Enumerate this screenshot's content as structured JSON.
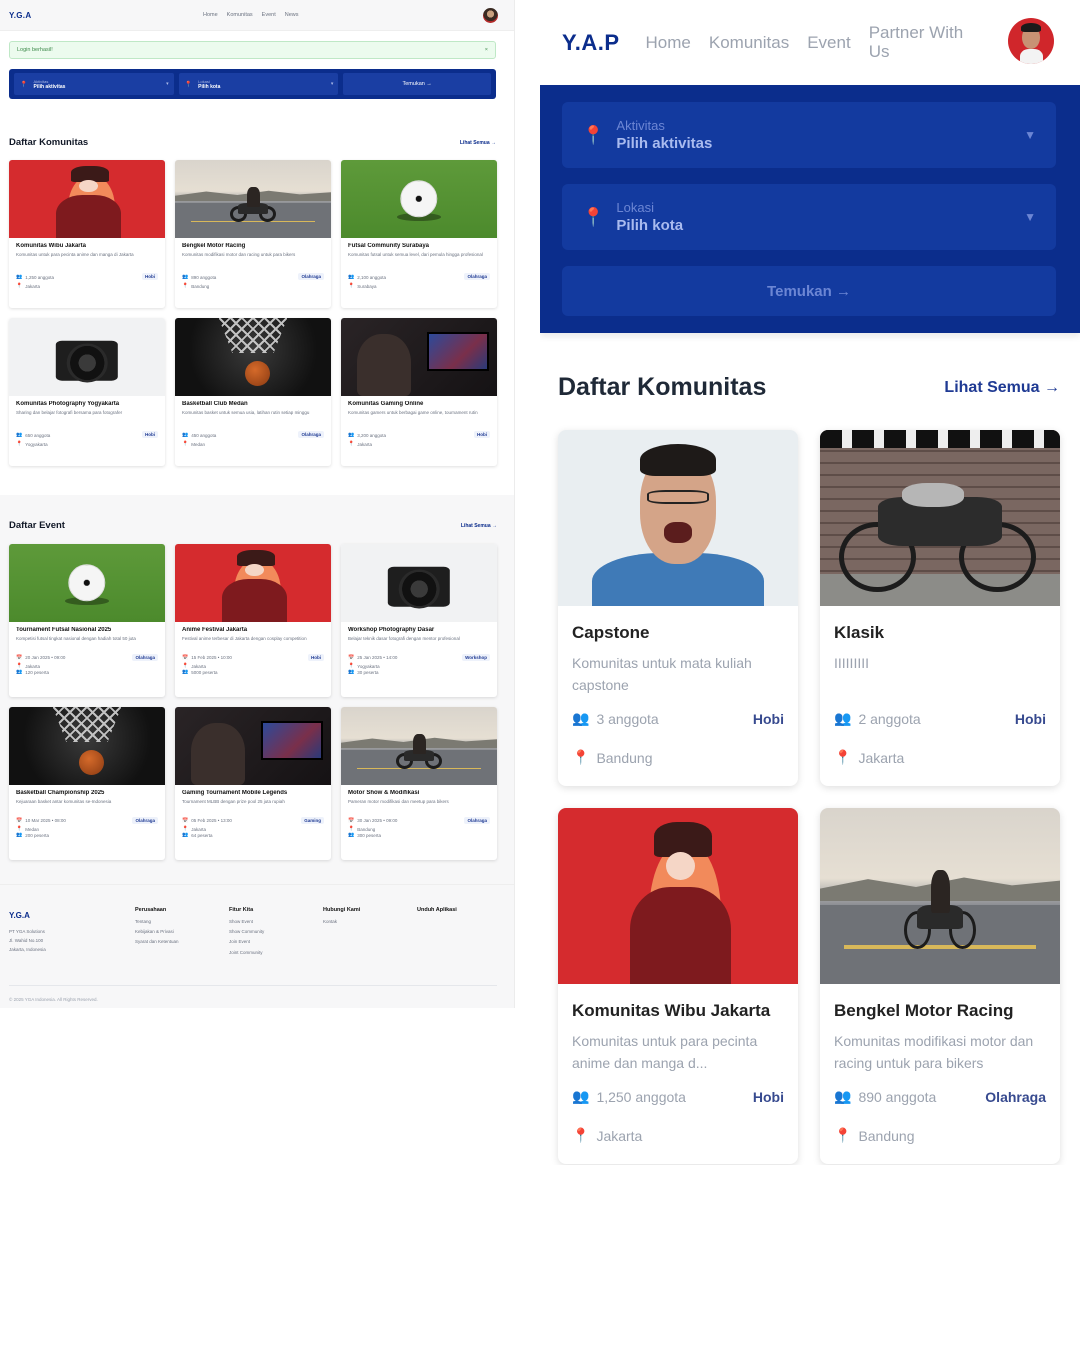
{
  "desktop": {
    "nav": {
      "logo": "Y.G.A",
      "links": [
        "Home",
        "Komunitas",
        "Event",
        "News"
      ]
    },
    "alert": {
      "text": "Login berhasil!",
      "close": "×"
    },
    "search": {
      "activity_label": "Aktivitas",
      "activity_value": "Pilih aktivitas",
      "location_label": "Lokasi",
      "location_value": "Pilih kota",
      "find_label": "Temukan →"
    },
    "komunitas": {
      "title": "Daftar Komunitas",
      "link": "Lihat Semua →",
      "items": [
        {
          "title": "Komunitas Wibu Jakarta",
          "desc": "Komunitas untuk para pecinta anime dan manga di Jakarta",
          "members": "1,250 anggota",
          "category": "Hobi",
          "location": "Jakarta",
          "image": "wibu"
        },
        {
          "title": "Bengkel Motor Racing",
          "desc": "Komunitas modifikasi motor dan racing untuk para bikers",
          "members": "890 anggota",
          "category": "Olahraga",
          "location": "Bandung",
          "image": "motor"
        },
        {
          "title": "Futsal Community Surabaya",
          "desc": "Komunitas futsal untuk semua level, dari pemula hingga profesional",
          "members": "2,100 anggota",
          "category": "Olahraga",
          "location": "Surabaya",
          "image": "soccer"
        },
        {
          "title": "Komunitas Photography Yogyakarta",
          "desc": "Sharing dan belajar fotografi bersama para fotografer",
          "members": "650 anggota",
          "category": "Hobi",
          "location": "Yogyakarta",
          "image": "camera"
        },
        {
          "title": "Basketball Club Medan",
          "desc": "Komunitas basket untuk semua usia, latihan rutin setiap minggu",
          "members": "450 anggota",
          "category": "Olahraga",
          "location": "Medan",
          "image": "basket"
        },
        {
          "title": "Komunitas Gaming Online",
          "desc": "Komunitas gamers untuk berbagai game online, tournament rutin",
          "members": "3,200 anggota",
          "category": "Hobi",
          "location": "Jakarta",
          "image": "gaming"
        }
      ]
    },
    "event": {
      "title": "Daftar Event",
      "link": "Lihat Semua →",
      "items": [
        {
          "title": "Tournament Futsal Nasional 2025",
          "desc": "Kompetisi futsal tingkat nasional dengan hadiah total 50 juta",
          "date": "20 Jan 2025 • 09:00",
          "category": "Olahraga",
          "location": "Jakarta",
          "participants": "120 peserta",
          "image": "soccer"
        },
        {
          "title": "Anime Festival Jakarta",
          "desc": "Festival anime terbesar di Jakarta dengan cosplay competition",
          "date": "15 Feb 2025 • 10:00",
          "category": "Hobi",
          "location": "Jakarta",
          "participants": "5000 peserta",
          "image": "wibu"
        },
        {
          "title": "Workshop Photography Dasar",
          "desc": "Belajar teknik dasar fotografi dengan mentor profesional",
          "date": "25 Jan 2025 • 14:00",
          "category": "Workshop",
          "location": "Yogyakarta",
          "participants": "30 peserta",
          "image": "camera"
        },
        {
          "title": "Basketball Championship 2025",
          "desc": "Kejuaraan basket antar komunitas se-Indonesia",
          "date": "10 Mar 2025 • 08:00",
          "category": "Olahraga",
          "location": "Medan",
          "participants": "200 peserta",
          "image": "basket"
        },
        {
          "title": "Gaming Tournament Mobile Legends",
          "desc": "Tournament MLBB dengan prize pool 25 juta rupiah",
          "date": "05 Feb 2025 • 13:00",
          "category": "Gaming",
          "location": "Jakarta",
          "participants": "64 peserta",
          "image": "gaming"
        },
        {
          "title": "Motor Show & Modifikasi",
          "desc": "Pameran motor modifikasi dan meetup para bikers",
          "date": "30 Jan 2025 • 09:00",
          "category": "Olahraga",
          "location": "Bandung",
          "participants": "300 peserta",
          "image": "motor"
        }
      ]
    },
    "footer": {
      "logo": "Y.G.A",
      "address": [
        "PT YGA Solutions",
        "Jl. Wahid No.100",
        "Jakarta, Indonesia"
      ],
      "cols": [
        {
          "title": "Perusahaan",
          "items": [
            "Tentang",
            "Kebijakan & Privasi",
            "Syarat dan Ketentuan"
          ]
        },
        {
          "title": "Fitur Kita",
          "items": [
            "Show Event",
            "Show Community",
            "Join Event",
            "Joint Community"
          ]
        },
        {
          "title": "Hubungi Kami",
          "items": [
            "Kontak"
          ]
        },
        {
          "title": "Unduh Aplikasi",
          "items": []
        }
      ],
      "copyright": "© 2025 YGA Indonesia. All Rights Reserved."
    }
  },
  "mobile": {
    "nav": {
      "logo": "Y.A.P",
      "links": [
        "Home",
        "Komunitas",
        "Event",
        "Partner With Us"
      ]
    },
    "search": {
      "activity_label": "Aktivitas",
      "activity_value": "Pilih aktivitas",
      "location_label": "Lokasi",
      "location_value": "Pilih kota",
      "find_label": "Temukan →"
    },
    "komunitas": {
      "title": "Daftar Komunitas",
      "link": "Lihat Semua →",
      "items": [
        {
          "title": "Capstone",
          "desc": "Komunitas untuk mata kuliah capstone",
          "members": "3 anggota",
          "category": "Hobi",
          "location": "Bandung",
          "image": "capstone"
        },
        {
          "title": "Klasik",
          "desc": "IIIIIIIII",
          "members": "2 anggota",
          "category": "Hobi",
          "location": "Jakarta",
          "image": "klasik"
        },
        {
          "title": "Komunitas Wibu Jakarta",
          "desc": "Komunitas untuk para pecinta anime dan manga d...",
          "members": "1,250 anggota",
          "category": "Hobi",
          "location": "Jakarta",
          "image": "wibu"
        },
        {
          "title": "Bengkel Motor Racing",
          "desc": "Komunitas modifikasi motor dan racing untuk para bikers",
          "members": "890 anggota",
          "category": "Olahraga",
          "location": "Bandung",
          "image": "motor"
        }
      ]
    }
  },
  "colors": {
    "brand": "#0b2d8c",
    "pin": "#e04b6e",
    "alert_bg": "#ecfbee",
    "alert_text": "#3e8a4b"
  }
}
